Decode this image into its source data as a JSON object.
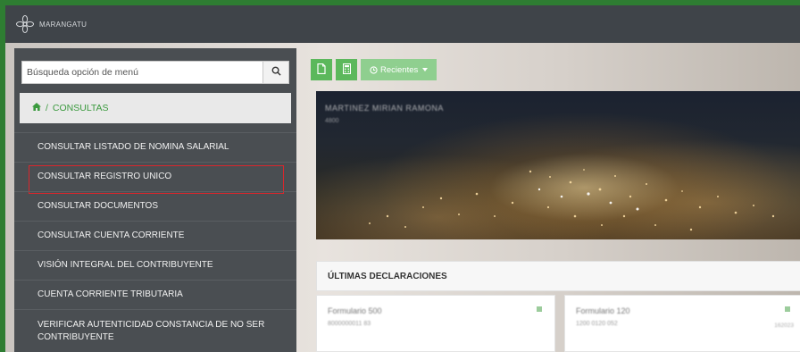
{
  "app": {
    "brand": "MARANGATU"
  },
  "search": {
    "placeholder": "Búsqueda opción de menú"
  },
  "breadcrumb": {
    "section": "CONSULTAS"
  },
  "menu": {
    "items": [
      {
        "label": "CONSULTAR LISTADO DE NOMINA SALARIAL"
      },
      {
        "label": "CONSULTAR REGISTRO UNICO"
      },
      {
        "label": "CONSULTAR DOCUMENTOS"
      },
      {
        "label": "CONSULTAR CUENTA CORRIENTE"
      },
      {
        "label": "VISIÓN INTEGRAL DEL CONTRIBUYENTE"
      },
      {
        "label": "CUENTA CORRIENTE TRIBUTARIA"
      },
      {
        "label": "VERIFICAR AUTENTICIDAD CONSTANCIA DE NO SER CONTRIBUYENTE"
      }
    ]
  },
  "toolbar": {
    "recent_label": "Recientes"
  },
  "hero": {
    "name": "MARTINEZ MIRIAN RAMONA",
    "subtitle": "4800"
  },
  "declarations": {
    "title": "ÚLTIMAS DECLARACIONES",
    "cards": [
      {
        "title": "Formulario 500",
        "subtitle": "8000000011 83",
        "meta": ""
      },
      {
        "title": "Formulario 120",
        "subtitle": "1200 0120 052",
        "meta": "162023"
      }
    ]
  },
  "colors": {
    "accent": "#5cb85c",
    "highlight": "#d9262c",
    "sidebar": "#4a4e52",
    "topbar": "#3f4449"
  }
}
